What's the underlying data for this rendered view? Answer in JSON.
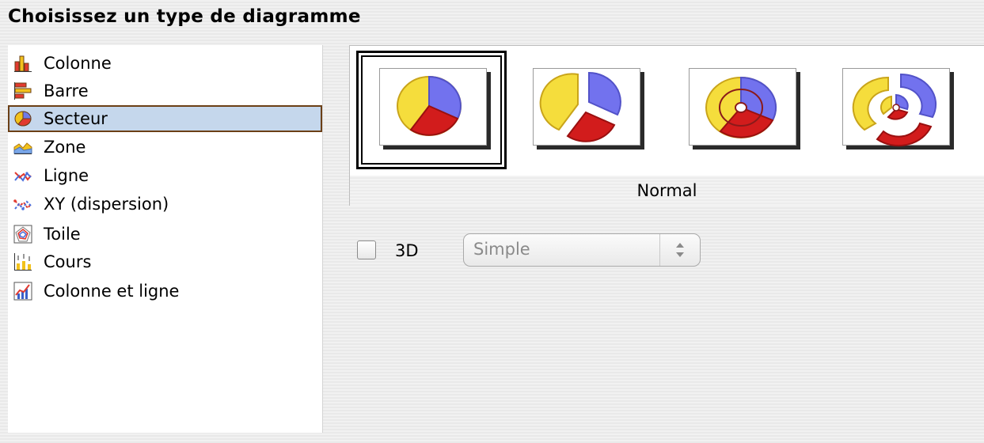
{
  "dialog": {
    "title": "Choisissez un type de diagramme"
  },
  "chart_types": {
    "selected_index": 2,
    "items": [
      {
        "label": "Colonne",
        "icon": "column-chart-icon"
      },
      {
        "label": "Barre",
        "icon": "bar-chart-icon"
      },
      {
        "label": "Secteur",
        "icon": "pie-chart-icon"
      },
      {
        "label": "Zone",
        "icon": "area-chart-icon"
      },
      {
        "label": "Ligne",
        "icon": "line-chart-icon"
      },
      {
        "label": "XY (dispersion)",
        "icon": "xy-scatter-chart-icon"
      },
      {
        "label": "Toile",
        "icon": "net-chart-icon"
      },
      {
        "label": "Cours",
        "icon": "stock-chart-icon"
      },
      {
        "label": "Colonne et ligne",
        "icon": "column-and-line-chart-icon"
      }
    ]
  },
  "variants": {
    "selected_name": "Normal",
    "items": [
      {
        "icon": "pie-normal-icon",
        "selected": true
      },
      {
        "icon": "pie-exploded-icon",
        "selected": false
      },
      {
        "icon": "donut-icon",
        "selected": false
      },
      {
        "icon": "donut-exploded-icon",
        "selected": false
      }
    ]
  },
  "options": {
    "three_d_label": "3D",
    "three_d_checked": false,
    "shape_select_value": "Simple",
    "shape_select_enabled": false
  },
  "colors": {
    "selection_background": "#c5d7ec",
    "selection_border": "#6b3f16",
    "pie_yellow": "#f5dd3c",
    "pie_blue": "#7272ee",
    "pie_red": "#d21c1c"
  }
}
